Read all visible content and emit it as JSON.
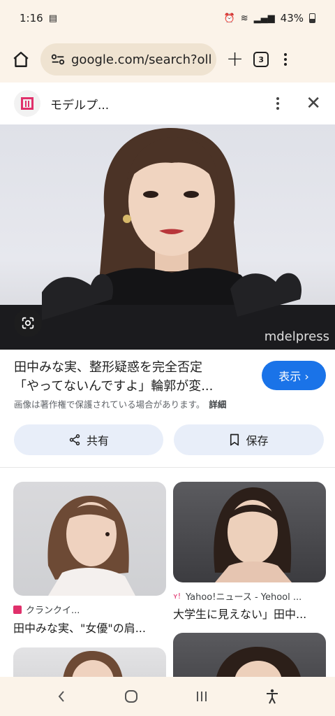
{
  "status": {
    "time": "1:16",
    "battery": "43%"
  },
  "browser": {
    "url": "google.com/search?oll",
    "tab_count": "3"
  },
  "source": {
    "name": "モデルプ..."
  },
  "result": {
    "title_line1": "田中みな実、整形疑惑を完全否定",
    "title_line2": "「やってないんですよ」輪郭が変...",
    "visit_label": "表示 ›",
    "notice": "画像は著作権で保護されている場合があります。",
    "notice_link": "詳細",
    "watermark": "mdelpress",
    "share_label": "共有",
    "save_label": "保存"
  },
  "related": [
    {
      "source": "クランクイ...",
      "title": "田中みな実、\"女優\"の肩..."
    },
    {
      "source": "Yahoo!ニュース - Yehool ...",
      "title": "大学生に見えない」田中..."
    }
  ],
  "colors": {
    "accent": "#1a73e8",
    "chrome_bg": "#fbf3e9",
    "pill_bg": "#e8eef9",
    "brand_pink": "#e0306b"
  }
}
